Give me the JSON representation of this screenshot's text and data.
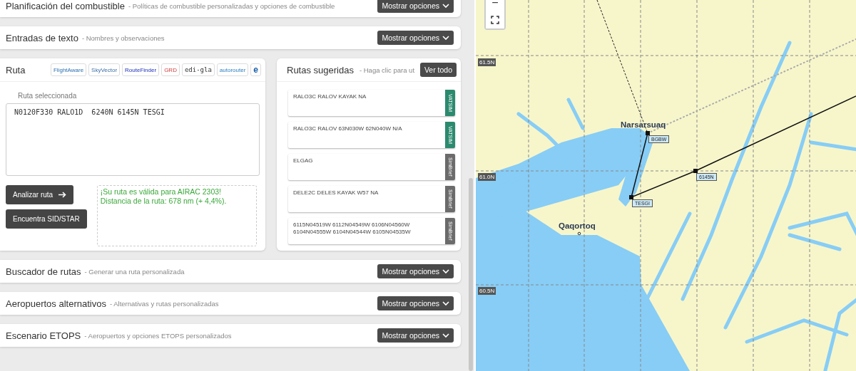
{
  "top_sections": [
    {
      "title": "Planificación del combustible",
      "subtitle": "- Políticas de combustible personalizadas y opciones de combustible",
      "button": "Mostrar opciones"
    },
    {
      "title": "Entradas de texto",
      "subtitle": "- Nombres y observaciones",
      "button": "Mostrar opciones"
    }
  ],
  "route": {
    "title": "Ruta",
    "tools": [
      {
        "label": "FlightAware",
        "kind": "logo"
      },
      {
        "label": "SkyVector",
        "kind": "logo"
      },
      {
        "label": "RouteFinder",
        "kind": "logo"
      },
      {
        "label": "GRD",
        "kind": "logo"
      },
      {
        "label": "edi-gla",
        "kind": "mono"
      },
      {
        "label": "autorouter",
        "kind": "logo"
      },
      {
        "label": "e",
        "kind": "icon"
      }
    ],
    "field_label": "Ruta seleccionada",
    "value": "N0120F330 RALO1D  6240N 6145N TESGI",
    "buttons": [
      {
        "label": "Analizar ruta",
        "arrow": true
      },
      {
        "label": "Encuentra SID/STAR",
        "arrow": false
      }
    ],
    "messages": [
      "¡Su ruta es válida para AIRAC 2303!",
      "Distancia de la ruta: 678 nm (+ 4,4%)."
    ]
  },
  "suggested": {
    "title": "Rutas sugeridas",
    "subtitle": "- Haga clic para ut",
    "button": "Ver todo",
    "items": [
      {
        "text": "RALO3C RALOV KAYAK NA",
        "source": "VATSIM",
        "color": "#2b8a6e"
      },
      {
        "text": "RALO3C RALOV 63N030W 62N040W N/A",
        "source": "VATSIM",
        "color": "#2b8a6e"
      },
      {
        "text": "ELGAG",
        "source": "SimBrief",
        "color": "#6b6b6b"
      },
      {
        "text": "DELE2C DELES KAYAK W57 NA",
        "source": "SimBrief",
        "color": "#6b6b6b"
      },
      {
        "text": "6115N04519W 6112N04549W 6106N04560W 6104N04555W 6104N04544W 6105N04535W",
        "source": "SimBrief",
        "color": "#6b6b6b"
      }
    ]
  },
  "bottom_sections": [
    {
      "title": "Buscador de rutas",
      "subtitle": "- Generar una ruta personalizada",
      "button": "Mostrar opciones"
    },
    {
      "title": "Aeropuertos alternativos",
      "subtitle": "- Alternativas y rutas personalizadas",
      "button": "Mostrar opciones"
    },
    {
      "title": "Escenario ETOPS",
      "subtitle": "- Aeropuertos y opciones ETOPS personalizados",
      "button": "Mostrar opciones"
    }
  ],
  "map": {
    "zoom_out": "−",
    "latitudes": [
      "61.5N",
      "61.0N",
      "60.5N"
    ],
    "places": [
      "Narsarsuaq",
      "Qaqortoq"
    ],
    "waypoints": [
      "BGBW",
      "6145N",
      "TESGI"
    ]
  }
}
